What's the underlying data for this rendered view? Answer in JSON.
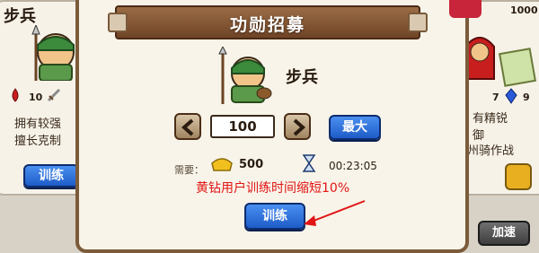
{
  "modal": {
    "title": "功勋招募",
    "unit_name": "步兵",
    "quantity": "100",
    "max_label": "最大",
    "cost_label": "需要：",
    "gold_amount": "500",
    "time": "00:23:05",
    "vip_note": "黄钻用户训练时间缩短10%",
    "train_label": "训练"
  },
  "left_card": {
    "title": "步兵",
    "stat_attack": "10",
    "desc_line1": "拥有较强",
    "desc_line2": "擅长克制",
    "train_label": "训练"
  },
  "right_card": {
    "stat_a": "7",
    "stat_b": "9",
    "desc_line1": "有精锐",
    "desc_line2": "御",
    "desc_line3": "州骑作战",
    "speedup_label": "加速"
  },
  "top_right_number": "1000",
  "colors": {
    "accent_red": "#e11515",
    "brown": "#7b5b3a",
    "blue_button": "#2a6bd8"
  }
}
